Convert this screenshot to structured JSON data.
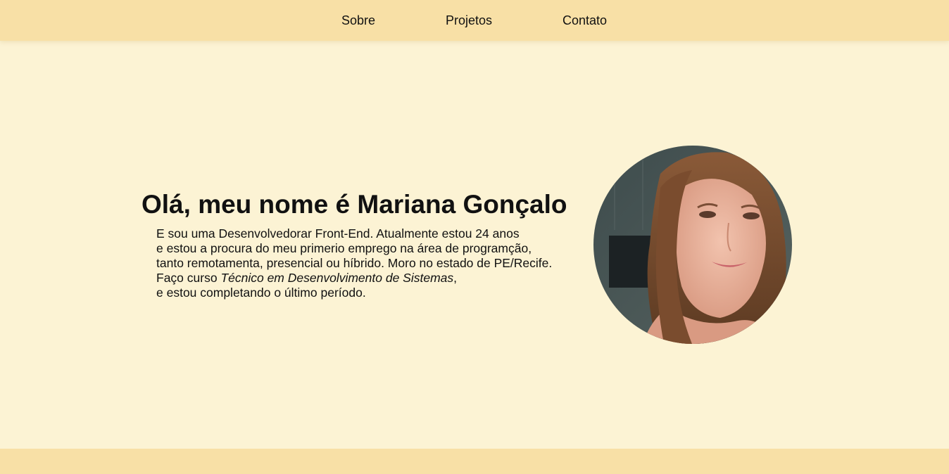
{
  "nav": {
    "items": [
      {
        "label": "Sobre"
      },
      {
        "label": "Projetos"
      },
      {
        "label": "Contato"
      }
    ]
  },
  "hero": {
    "title": "Olá, meu nome é Mariana Gonçalo",
    "line1": "E sou uma Desenvolvedorar Front-End. Atualmente estou 24 anos",
    "line2": "e estou a procura do meu primerio emprego na área de programção,",
    "line3": "tanto remotamenta, presencial ou híbrido. Moro no estado de PE/Recife.",
    "line4_prefix": "Faço curso ",
    "line4_course": "Técnico em Desenvolvimento de Sistemas",
    "line4_suffix": ",",
    "line5": "e estou completando o último período."
  },
  "colors": {
    "background": "#fcf3d4",
    "header": "#f8e0a6",
    "footer": "#f8e0a6"
  }
}
